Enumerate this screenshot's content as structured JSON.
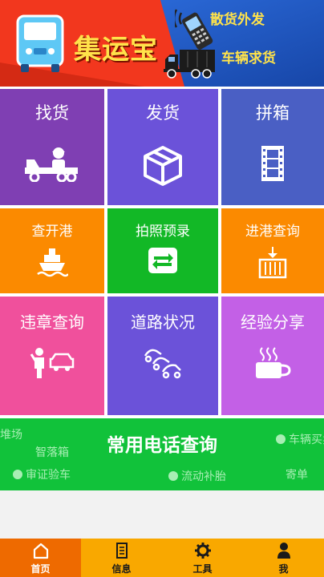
{
  "banner": {
    "brand": "集运宝",
    "slogan_top": "散货外发",
    "slogan_bottom": "车辆求货",
    "colors": {
      "red": "#f2371e",
      "blue": "#1b56c2",
      "yellow": "#ffe34a"
    }
  },
  "tiles": [
    {
      "label": "找货",
      "icon": "truck-driver-icon",
      "color": "#7f3fb3"
    },
    {
      "label": "发货",
      "icon": "box-icon",
      "color": "#6b52d9"
    },
    {
      "label": "拼箱",
      "icon": "film-strip-icon",
      "color": "#4a5fc4"
    },
    {
      "label": "查开港",
      "icon": "ship-icon",
      "color": "#fb8a00"
    },
    {
      "label": "拍照预录",
      "icon": "swap-arrows-icon",
      "color": "#12b826"
    },
    {
      "label": "进港查询",
      "icon": "container-crane-icon",
      "color": "#fb8a00"
    },
    {
      "label": "违章查询",
      "icon": "traffic-police-icon",
      "color": "#f0509c"
    },
    {
      "label": "道路状况",
      "icon": "traffic-cars-icon",
      "color": "#6b52d9"
    },
    {
      "label": "经验分享",
      "icon": "coffee-cup-icon",
      "color": "#c360e6"
    }
  ],
  "phone_query": {
    "title": "常用电话查询",
    "ghost_items": [
      "堆场",
      "智落箱",
      "车辆买卖",
      "审证验车",
      "流动补胎",
      "寄单"
    ]
  },
  "nav": {
    "items": [
      {
        "label": "首页",
        "icon": "home-icon",
        "active": true
      },
      {
        "label": "信息",
        "icon": "document-icon",
        "active": false
      },
      {
        "label": "工具",
        "icon": "gear-icon",
        "active": false
      },
      {
        "label": "我",
        "icon": "person-icon",
        "active": false
      }
    ],
    "colors": {
      "bar": "#f9a800",
      "active": "#ee6a00"
    }
  }
}
